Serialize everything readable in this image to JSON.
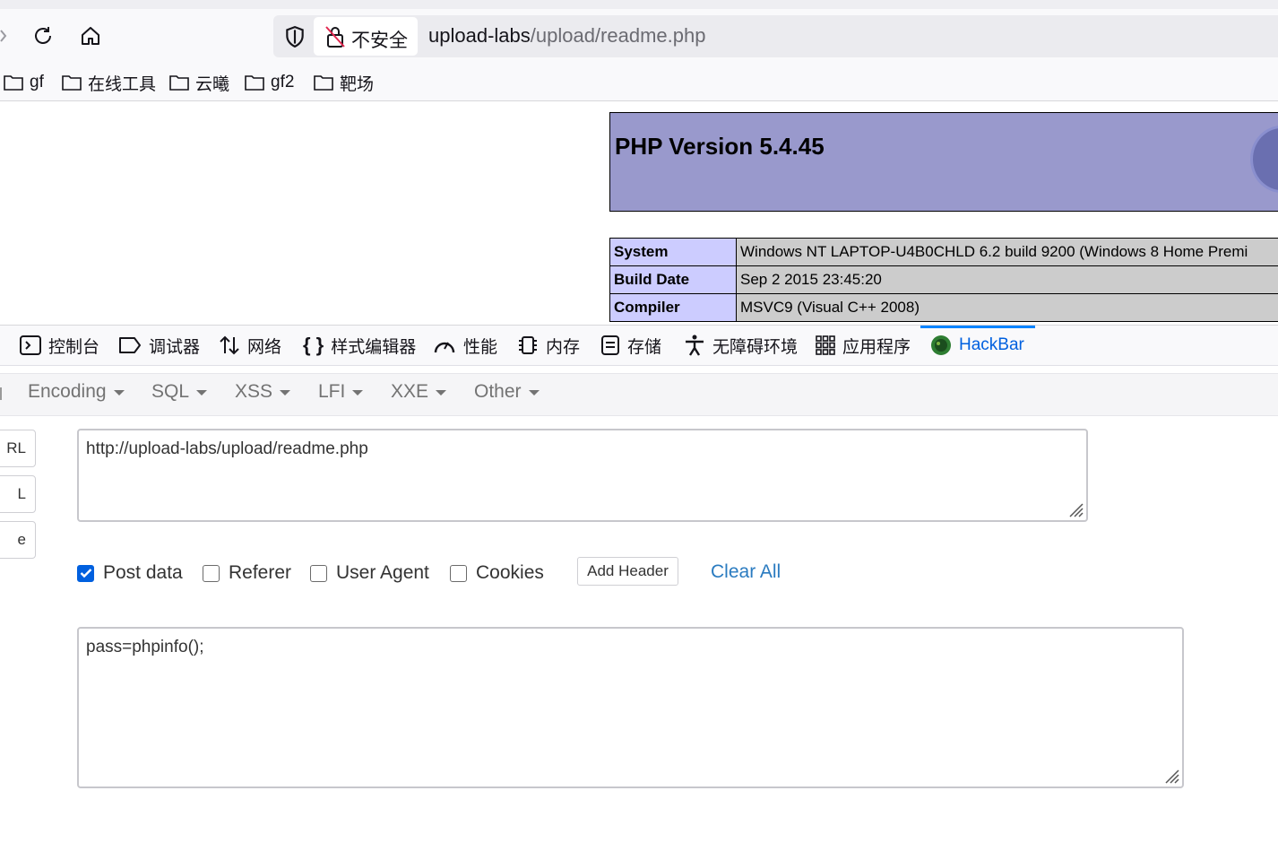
{
  "browser": {
    "security_label": "不安全",
    "url_host": "upload-labs",
    "url_path": "/upload/readme.php",
    "bookmarks": [
      {
        "label": "gf"
      },
      {
        "label": "在线工具"
      },
      {
        "label": "云曦"
      },
      {
        "label": "gf2"
      },
      {
        "label": "靶场"
      }
    ]
  },
  "page": {
    "php_title": "PHP Version 5.4.45",
    "info_rows": [
      {
        "key": "System",
        "value": "Windows NT LAPTOP-U4B0CHLD 6.2 build 9200 (Windows 8 Home Premi"
      },
      {
        "key": "Build Date",
        "value": "Sep 2 2015 23:45:20"
      },
      {
        "key": "Compiler",
        "value": "MSVC9 (Visual C++ 2008)"
      }
    ]
  },
  "devtools": {
    "tabs": [
      {
        "label": "控制台",
        "icon": "console-icon"
      },
      {
        "label": "调试器",
        "icon": "debugger-icon"
      },
      {
        "label": "网络",
        "icon": "network-icon"
      },
      {
        "label": "样式编辑器",
        "icon": "style-editor-icon"
      },
      {
        "label": "性能",
        "icon": "performance-icon"
      },
      {
        "label": "内存",
        "icon": "memory-icon"
      },
      {
        "label": "存储",
        "icon": "storage-icon"
      },
      {
        "label": "无障碍环境",
        "icon": "accessibility-icon"
      },
      {
        "label": "应用程序",
        "icon": "application-icon"
      },
      {
        "label": "HackBar",
        "icon": "hackbar-icon",
        "active": true
      }
    ]
  },
  "hackbar": {
    "menu": [
      "Encoding",
      "SQL",
      "XSS",
      "LFI",
      "XXE",
      "Other"
    ],
    "side_buttons": [
      "RL",
      "L",
      "e"
    ],
    "url_value": "http://upload-labs/upload/readme.php",
    "options": [
      {
        "label": "Post data",
        "checked": true
      },
      {
        "label": "Referer",
        "checked": false
      },
      {
        "label": "User Agent",
        "checked": false
      },
      {
        "label": "Cookies",
        "checked": false
      }
    ],
    "add_header_label": "Add Header",
    "clear_all_label": "Clear All",
    "post_value": "pass=phpinfo();"
  },
  "colors": {
    "accent": "#0060df",
    "php_header": "#9999cc",
    "php_key_bg": "#ccccff",
    "php_value_bg": "#cccccc",
    "link": "#2a7bc0"
  }
}
